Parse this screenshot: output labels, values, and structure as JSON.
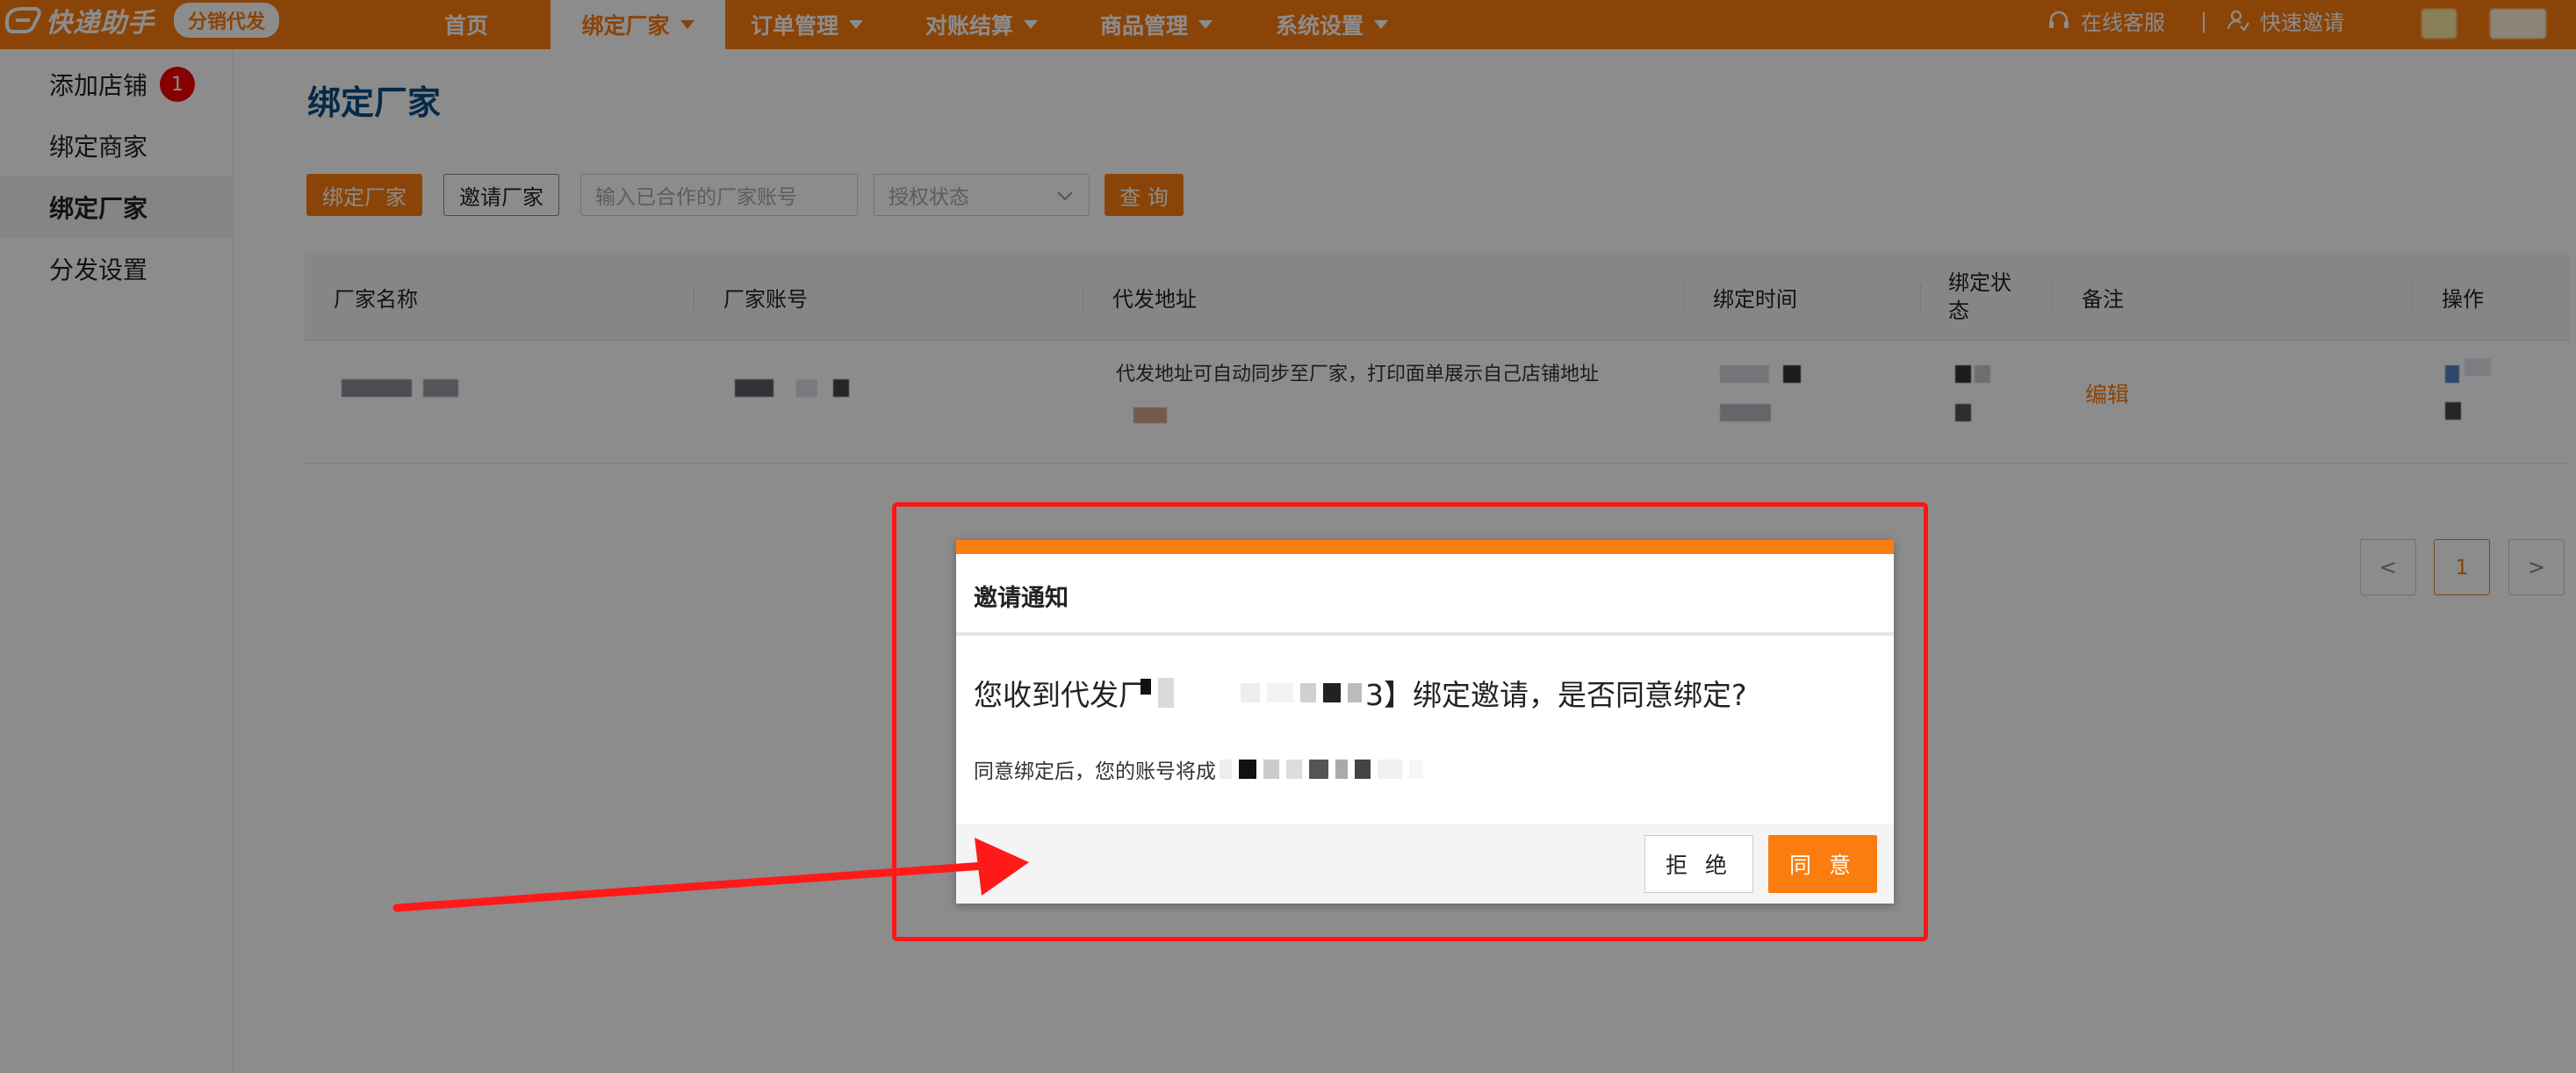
{
  "brand": {
    "name": "快递助手",
    "badge": "分销代发"
  },
  "nav": {
    "items": [
      {
        "label": "首页"
      },
      {
        "label": "绑定厂家",
        "active": true
      },
      {
        "label": "订单管理"
      },
      {
        "label": "对账结算"
      },
      {
        "label": "商品管理"
      },
      {
        "label": "系统设置"
      }
    ],
    "right": [
      {
        "label": "在线客服",
        "icon": "headset-icon"
      },
      {
        "label": "快速邀请",
        "icon": "user-add-icon"
      }
    ],
    "separator": "|"
  },
  "sidebar": {
    "items": [
      {
        "label": "添加店铺",
        "badge": "1"
      },
      {
        "label": "绑定商家"
      },
      {
        "label": "绑定厂家",
        "active": true
      },
      {
        "label": "分发设置"
      }
    ]
  },
  "page": {
    "title": "绑定厂家",
    "toolbar": {
      "bind_button": "绑定厂家",
      "invite_button": "邀请厂家",
      "account_placeholder": "输入已合作的厂家账号",
      "status_placeholder": "授权状态",
      "query_button": "查 询"
    },
    "table": {
      "headers": [
        "厂家名称",
        "厂家账号",
        "代发地址",
        "绑定时间",
        "绑定状\n态",
        "备注",
        "操作"
      ],
      "rows": [
        {
          "address_note": "代发地址可自动同步至厂家，打印面单展示自己店铺地址",
          "remark_action": "编辑"
        }
      ]
    },
    "pagination": {
      "prev": "<",
      "current": "1",
      "next": ">"
    }
  },
  "modal": {
    "title": "邀请通知",
    "message_prefix": "您收到代发厂",
    "message_suffix": "3】绑定邀请，是否同意绑定?",
    "sub_prefix": "同意绑定后，您的账号将成",
    "reject_label": "拒 绝",
    "agree_label": "同 意"
  },
  "colors": {
    "accent": "#fb7d0f",
    "title_blue": "#0a4e86",
    "annotation_red": "#ff1515"
  }
}
